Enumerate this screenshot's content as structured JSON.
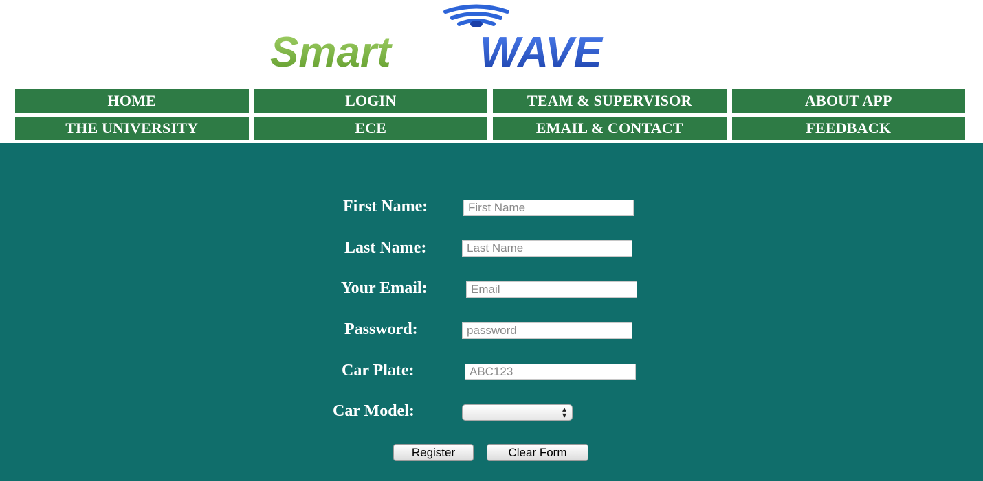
{
  "logo": {
    "part1": "Smart",
    "part2": "WAVE",
    "colors": {
      "green": "#7cb342",
      "blue": "#1e4fc4"
    }
  },
  "nav": {
    "row1": [
      "HOME",
      "LOGIN",
      "TEAM & SUPERVISOR",
      "ABOUT APP"
    ],
    "row2": [
      "THE UNIVERSITY",
      "ECE",
      "EMAIL & CONTACT",
      "FEEDBACK"
    ]
  },
  "form": {
    "first_name": {
      "label": "First Name:",
      "placeholder": "First Name"
    },
    "last_name": {
      "label": "Last Name:",
      "placeholder": "Last Name"
    },
    "email": {
      "label": "Your Email:",
      "placeholder": "Email"
    },
    "password": {
      "label": "Password:",
      "placeholder": "password"
    },
    "car_plate": {
      "label": "Car Plate:",
      "placeholder": "ABC123"
    },
    "car_model": {
      "label": "Car Model:",
      "value": ""
    },
    "register_label": "Register",
    "clear_label": "Clear Form"
  },
  "colors": {
    "nav_bg": "#2e7b45",
    "panel_bg": "#106e6b"
  }
}
